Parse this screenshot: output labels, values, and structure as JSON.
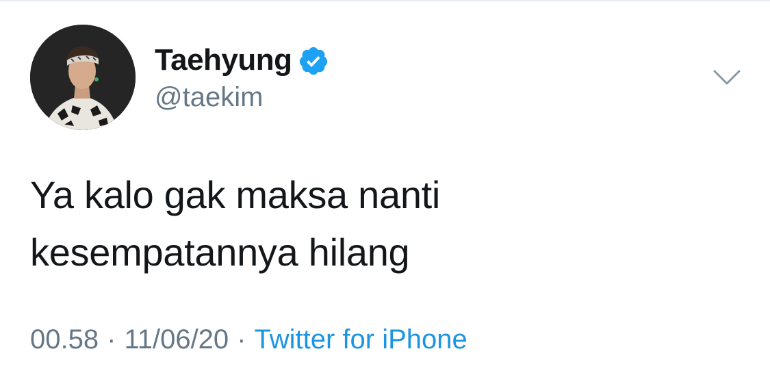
{
  "tweet": {
    "author": {
      "display_name": "Taehyung",
      "handle": "@taekim",
      "verified": true,
      "avatar_icon": "profile-photo"
    },
    "text_lines": [
      "Ya kalo gak maksa nanti",
      "kesempatannya hilang"
    ],
    "meta": {
      "time": "00.58",
      "separator": "·",
      "date": "11/06/20",
      "source": "Twitter for iPhone"
    },
    "menu_icon": "chevron-down-icon"
  },
  "colors": {
    "text_primary": "#14171a",
    "text_secondary": "#657786",
    "link": "#1b95e0",
    "verified_badge": "#1da1f2",
    "chevron": "#8899a6"
  }
}
